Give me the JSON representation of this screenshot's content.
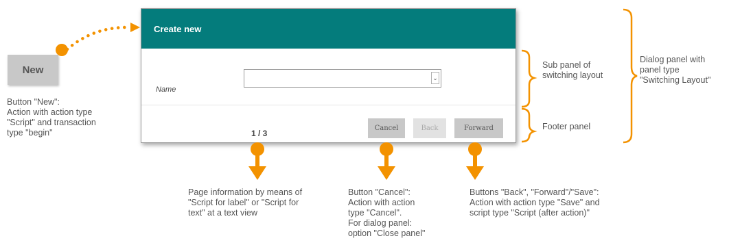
{
  "new_button": {
    "label": "New"
  },
  "dialog": {
    "title": "Create new",
    "name_label": "Name",
    "page_info": "1 / 3",
    "buttons": {
      "cancel": "Cancel",
      "back": "Back",
      "forward": "Forward"
    }
  },
  "annotations": {
    "sub_panel": [
      "Sub panel of",
      "switching layout"
    ],
    "dialog_panel": [
      "Dialog panel with",
      "panel type",
      "\"Switching Layout\""
    ],
    "footer_panel": [
      "Footer panel"
    ],
    "new_button_note": [
      "Button \"New\":",
      "Action with action type",
      "\"Script\" and transaction",
      "type \"begin\""
    ],
    "page_info_note": [
      "Page information by means of",
      "\"Script for label\" or \"Script for",
      "text\" at a text view"
    ],
    "cancel_note": [
      "Button \"Cancel\":",
      "Action with action",
      "type \"Cancel\".",
      "For dialog panel:",
      "option \"Close panel\""
    ],
    "buttons_note": [
      "Buttons \"Back\", \"Forward\"/\"Save\":",
      "Action with action type \"Save\" and",
      "script type \"Script (after action)\""
    ]
  },
  "colors": {
    "header": "#047c7c",
    "accent": "#f39200",
    "button": "#c8c8c8"
  }
}
